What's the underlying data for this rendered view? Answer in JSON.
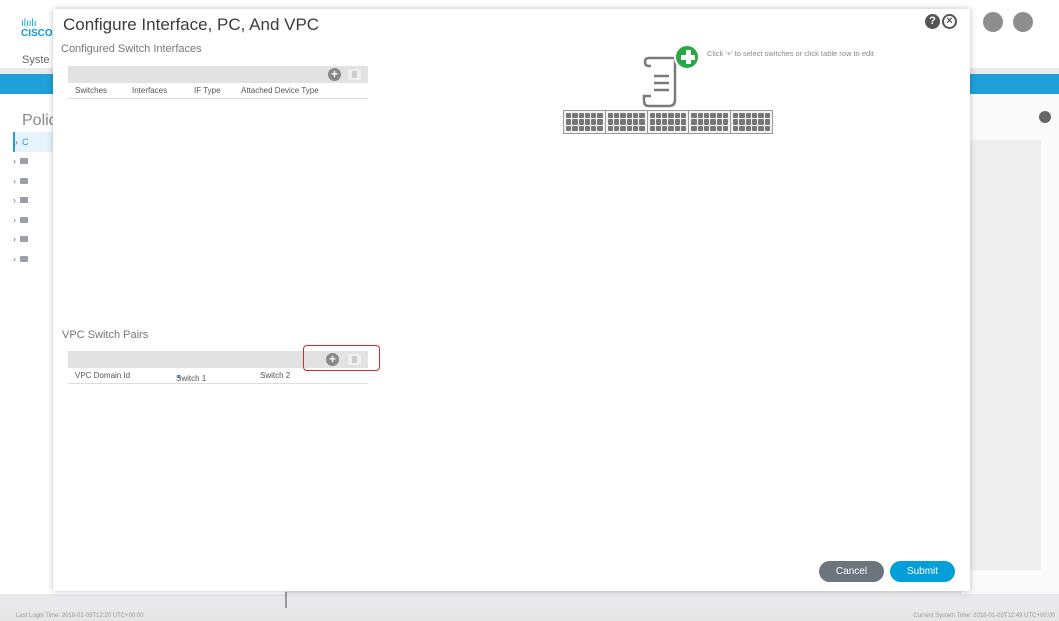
{
  "background": {
    "logo_bars": "ılıılı",
    "logo_word": "CISCO",
    "system_tab_label": "Syste",
    "panel_title": "Polic",
    "footer_left": "Last Login Time: 2018-01-03T12:20 UTC+00:00",
    "footer_right": "Current System Time: 2018-01-03T12:49 UTC+00:00",
    "header_icons": [
      "monitor-icon",
      "gear-icon"
    ]
  },
  "modal": {
    "title": "Configure Interface, PC, And VPC",
    "help_glyph": "?",
    "close_glyph": "×",
    "configured_interfaces": {
      "label": "Configured Switch Interfaces",
      "add_glyph": "+",
      "columns": [
        "Switches",
        "Interfaces",
        "IF Type",
        "Attached Device Type"
      ],
      "rows": []
    },
    "hint": "Click '+' to select switches or click table row to edit",
    "vpc_pairs": {
      "label": "VPC Switch Pairs",
      "add_glyph": "+",
      "columns": [
        "VPC Domain Id",
        "Switch 1",
        "Switch 2"
      ],
      "sorted_column": "Switch 1",
      "rows": []
    },
    "buttons": {
      "cancel": "Cancel",
      "submit": "Submit"
    }
  },
  "colors": {
    "accent": "#049fd9",
    "highlight": "#d42a2a",
    "add_green": "#28a745"
  }
}
